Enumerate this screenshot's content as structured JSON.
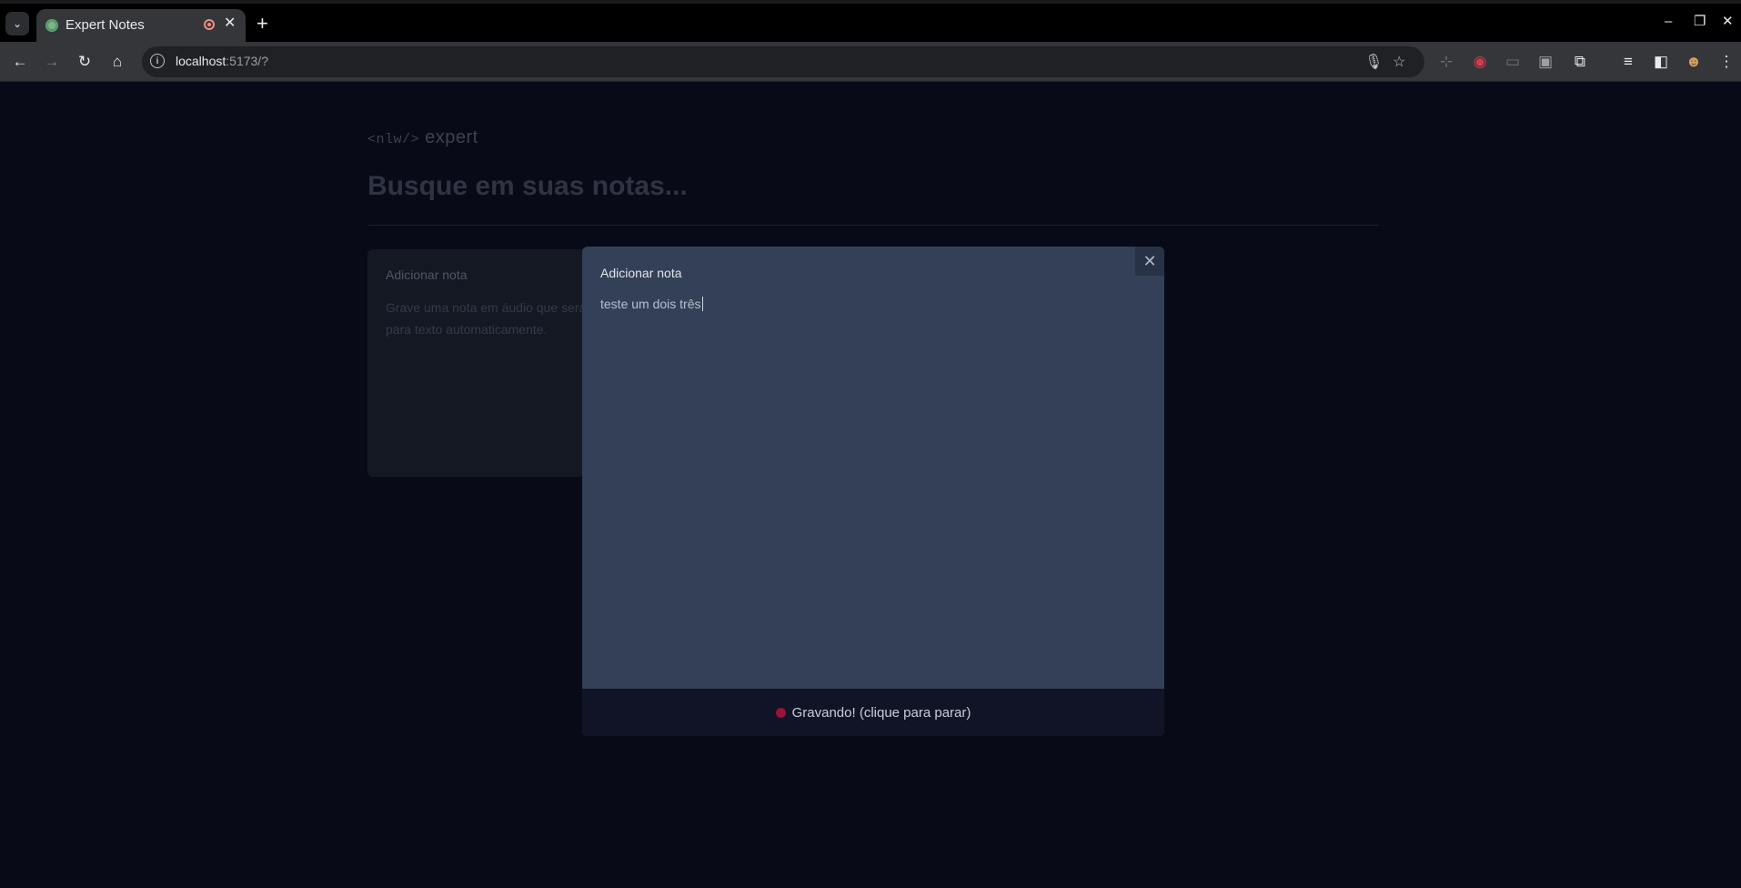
{
  "browser": {
    "tab_title": "Expert Notes",
    "tab_close": "✕",
    "new_tab": "+",
    "url_host": "localhost",
    "url_rest": ":5173/?",
    "window": {
      "minimize": "–",
      "restore": "❐",
      "close": "✕"
    }
  },
  "page": {
    "logo_tag": "<nlw/>",
    "logo_text": "expert",
    "search_placeholder": "Busque em suas notas...",
    "card": {
      "title": "Adicionar nota",
      "description": "Grave uma nota em áudio que será convertida para texto automaticamente."
    }
  },
  "modal": {
    "close_icon": "✕",
    "title": "Adicionar nota",
    "content": "teste um dois três",
    "footer_label": "Gravando! (clique para parar)",
    "recording_color": "#9a1238"
  }
}
